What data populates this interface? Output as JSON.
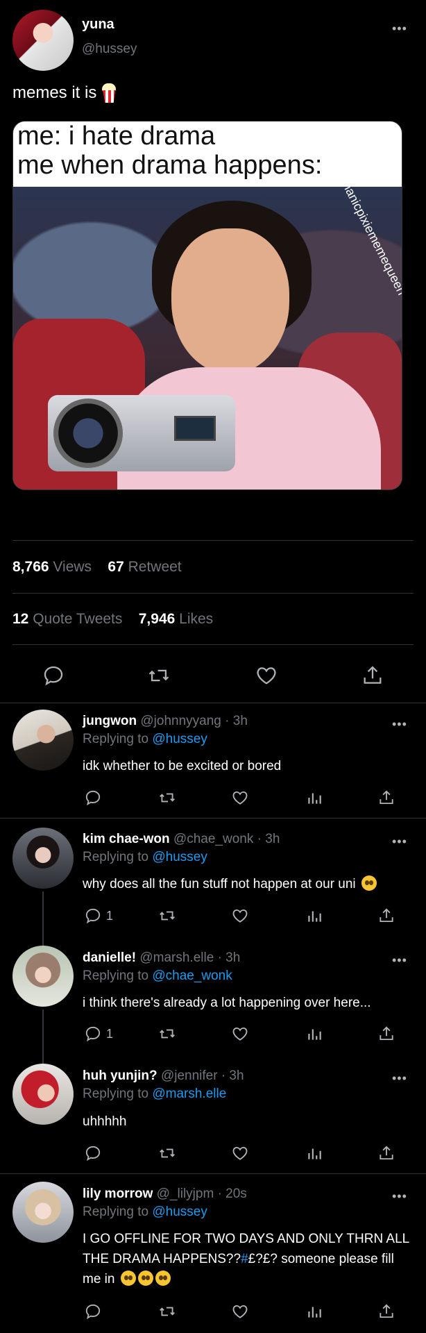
{
  "tweet": {
    "author_name": "yuna",
    "author_handle": "@hussey",
    "text": "memes it is",
    "meme_caption_line1": "me: i hate drama",
    "meme_caption_line2": "me when drama happens:",
    "meme_watermark": "@manicpixiememequeen",
    "views_count": "8,766",
    "views_label": "Views",
    "retweet_count": "67",
    "retweet_label": "Retweet",
    "quote_count": "12",
    "quote_label": "Quote Tweets",
    "likes_count": "7,946",
    "likes_label": "Likes"
  },
  "replies": [
    {
      "name": "jungwon",
      "handle": "@johnnyyang",
      "time": "· 3h",
      "replying_label": "Replying to",
      "replying_to": "@hussey",
      "text": "idk whether to be excited or bored",
      "reply_count": ""
    },
    {
      "name": "kim chae-won",
      "handle": "@chae_wonk",
      "time": "· 3h",
      "replying_label": "Replying to",
      "replying_to": "@hussey",
      "text": "why does all the fun stuff not happen at our uni",
      "reply_count": "1"
    },
    {
      "name": "danielle!",
      "handle": "@marsh.elle",
      "time": "· 3h",
      "replying_label": "Replying to",
      "replying_to": "@chae_wonk",
      "text": "i think there's already a lot happening over here...",
      "reply_count": "1"
    },
    {
      "name": "huh yunjin?",
      "handle": "@jennifer",
      "time": "· 3h",
      "replying_label": "Replying to",
      "replying_to": "@marsh.elle",
      "text": "uhhhhh",
      "reply_count": ""
    },
    {
      "name": "lily morrow",
      "handle": "@_lilyjpm",
      "time": "· 20s",
      "replying_label": "Replying to",
      "replying_to": "@hussey",
      "text_line1": "I GO OFFLINE FOR TWO DAYS AND ONLY THRN ALL",
      "text_line2a": "THE DRAMA HAPPENS??",
      "text_line2b": "#",
      "text_line2c": "£?£? someone please fill",
      "text_line3": "me in",
      "reply_count": ""
    }
  ],
  "colors": {
    "link": "#1d9bf0",
    "muted": "#71767b",
    "background": "#000000"
  },
  "icons": [
    "more-icon",
    "popcorn-icon",
    "reply-icon",
    "retweet-icon",
    "like-icon",
    "share-icon",
    "views-icon"
  ]
}
